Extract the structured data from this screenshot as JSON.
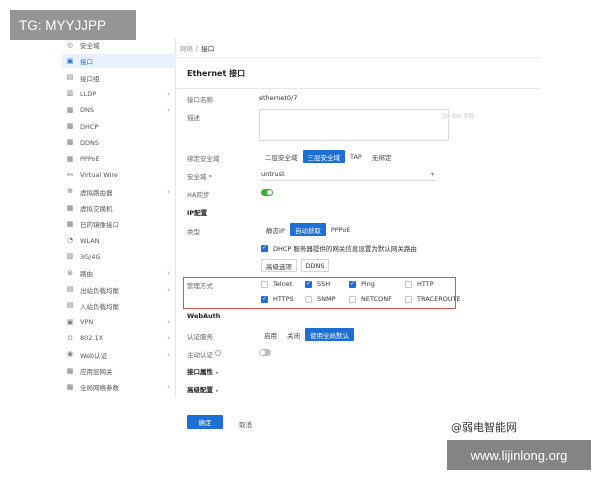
{
  "watermark": {
    "tag": "TG: MYYJJPP",
    "site_name": "@弱电智能网",
    "url": "www.lijinlong.org"
  },
  "sidebar": {
    "items": [
      {
        "label": "安全域",
        "icon": "globe-icon",
        "glyph": "◎",
        "chevron": false,
        "active": false
      },
      {
        "label": "接口",
        "icon": "interface-icon",
        "glyph": "▣",
        "chevron": false,
        "active": true
      },
      {
        "label": "接口组",
        "icon": "interface-group-icon",
        "glyph": "▤",
        "chevron": false,
        "active": false
      },
      {
        "label": "LLDP",
        "icon": "lldp-icon",
        "glyph": "▥",
        "chevron": true,
        "active": false
      },
      {
        "label": "DNS",
        "icon": "dns-icon",
        "glyph": "▦",
        "chevron": true,
        "active": false
      },
      {
        "label": "DHCP",
        "icon": "dhcp-icon",
        "glyph": "▦",
        "chevron": false,
        "active": false
      },
      {
        "label": "DDNS",
        "icon": "ddns-icon",
        "glyph": "▦",
        "chevron": false,
        "active": false
      },
      {
        "label": "PPPoE",
        "icon": "pppoe-icon",
        "glyph": "▦",
        "chevron": false,
        "active": false
      },
      {
        "label": "Virtual Wire",
        "icon": "virtual-wire-icon",
        "glyph": "⚯",
        "chevron": false,
        "active": false
      },
      {
        "label": "虚拟路由器",
        "icon": "virtual-router-icon",
        "glyph": "⊕",
        "chevron": true,
        "active": false
      },
      {
        "label": "虚拟交换机",
        "icon": "virtual-switch-icon",
        "glyph": "▦",
        "chevron": false,
        "active": false
      },
      {
        "label": "日的镜像接口",
        "icon": "mirror-interface-icon",
        "glyph": "▦",
        "chevron": false,
        "active": false
      },
      {
        "label": "WLAN",
        "icon": "wlan-icon",
        "glyph": "◔",
        "chevron": false,
        "active": false
      },
      {
        "label": "3G/4G",
        "icon": "cellular-icon",
        "glyph": "▥",
        "chevron": false,
        "active": false
      },
      {
        "label": "路由",
        "icon": "route-icon",
        "glyph": "⊛",
        "chevron": true,
        "active": false
      },
      {
        "label": "出站负载均衡",
        "icon": "outbound-lb-icon",
        "glyph": "▤",
        "chevron": true,
        "active": false
      },
      {
        "label": "入站负载均衡",
        "icon": "inbound-lb-icon",
        "glyph": "▤",
        "chevron": false,
        "active": false
      },
      {
        "label": "VPN",
        "icon": "vpn-icon",
        "glyph": "▣",
        "chevron": true,
        "active": false
      },
      {
        "label": "802.1X",
        "icon": "dot1x-icon",
        "glyph": "⊙",
        "chevron": true,
        "active": false
      },
      {
        "label": "Web认证",
        "icon": "web-auth-icon",
        "glyph": "◉",
        "chevron": true,
        "active": false
      },
      {
        "label": "应用层网关",
        "icon": "alg-icon",
        "glyph": "▦",
        "chevron": false,
        "active": false
      },
      {
        "label": "全局网络参数",
        "icon": "global-params-icon",
        "glyph": "▦",
        "chevron": true,
        "active": false
      }
    ]
  },
  "breadcrumb": {
    "parent": "网络",
    "sep": "/",
    "current": "接口"
  },
  "page": {
    "title": "Ethernet 接口"
  },
  "form": {
    "name_label": "接口名称",
    "name_value": "ethernet0/7",
    "desc_label": "描述",
    "desc_hint": "(0~63) 字符",
    "binding_label": "绑定安全域",
    "binding_options": [
      "二层安全域",
      "三层安全域",
      "TAP",
      "无绑定"
    ],
    "binding_selected": 1,
    "zone_label": "安全域 *",
    "zone_value": "untrust",
    "ha_label": "HA同步",
    "ip_section": "IP配置",
    "type_label": "类型",
    "type_options": [
      "静态IP",
      "自动获取",
      "PPPoE"
    ],
    "type_selected": 1,
    "dhcp_gateway_label": "DHCP 服务器提供的网关信息设置为默认网关路由",
    "advanced_btn": "高级选项",
    "ddns_btn": "DDNS",
    "mgmt_label": "管理方式",
    "mgmt": [
      {
        "label": "Telnet",
        "checked": false
      },
      {
        "label": "SSH",
        "checked": true
      },
      {
        "label": "Ping",
        "checked": true
      },
      {
        "label": "HTTP",
        "checked": false
      },
      {
        "label": "HTTPS",
        "checked": true
      },
      {
        "label": "SNMP",
        "checked": false
      },
      {
        "label": "NETCONF",
        "checked": false
      },
      {
        "label": "TRACEROUTE",
        "checked": false
      }
    ],
    "webauth_section": "WebAuth",
    "auth_label": "认证服务",
    "auth_options": [
      "启用",
      "关闭",
      "使用全局默认"
    ],
    "auth_selected": 2,
    "active_auth_label": "主动认证",
    "iface_props": "接口属性",
    "advanced_config": "高级配置",
    "ok": "确定",
    "cancel": "取消"
  }
}
